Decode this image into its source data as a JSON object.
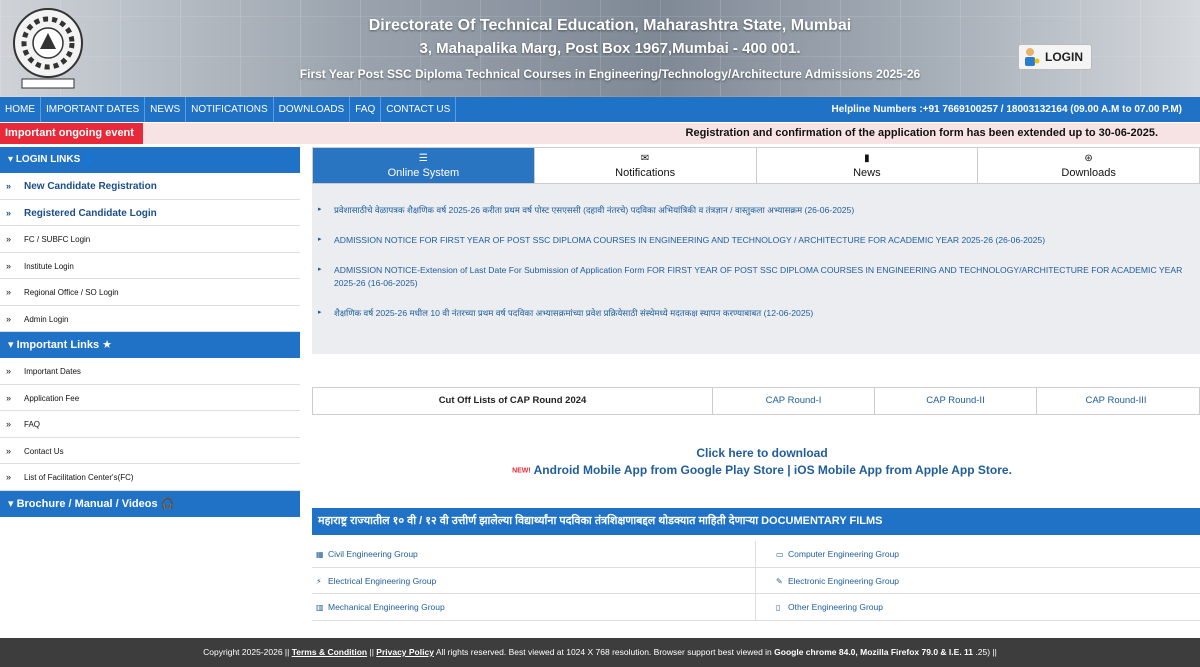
{
  "header": {
    "line1": "Directorate Of Technical Education, Maharashtra State, Mumbai",
    "line2": "3, Mahapalika Marg, Post Box 1967,Mumbai - 400 001.",
    "line3": "First Year Post SSC Diploma Technical Courses in Engineering/Technology/Architecture Admissions 2025-26",
    "login_label": "LOGIN"
  },
  "nav": {
    "items": [
      "HOME",
      "IMPORTANT DATES",
      "NEWS",
      "NOTIFICATIONS",
      "DOWNLOADS",
      "FAQ",
      "CONTACT US"
    ],
    "helpline": "Helpline Numbers  :+91 7669100257 / 18003132164   (09.00 A.M to 07.00 P.M)"
  },
  "ongoing": {
    "tag": "Important ongoing event",
    "message": "Registration and confirmation of the application form has been extended up to 30-06-2025."
  },
  "sidebar": {
    "login_head": "LOGIN LINKS",
    "login_items": [
      "New Candidate Registration",
      "Registered Candidate Login",
      "FC / SUBFC Login",
      "Institute Login",
      "Regional Office / SO Login",
      "Admin Login"
    ],
    "important_head": "Important Links",
    "important_items": [
      "Important Dates",
      "Application Fee",
      "FAQ",
      "Contact Us",
      "List of Facilitation Center's(FC)"
    ],
    "brochure_head": "Brochure / Manual / Videos"
  },
  "tabs": [
    "Online System",
    "Notifications",
    "News",
    "Downloads"
  ],
  "notices": [
    "प्रवेशासाठीचे वेळापत्रक शैक्षणिक वर्ष 2025-26 करीता प्रथम वर्ष पोस्ट एसएससी (दहावी नंतरचे) पदविका अभियांत्रिकी व तंत्रज्ञान / वास्तुकला अभ्यासक्रम (26-06-2025)",
    "ADMISSION NOTICE FOR FIRST YEAR OF POST SSC DIPLOMA COURSES IN ENGINEERING AND TECHNOLOGY / ARCHITECTURE FOR ACADEMIC YEAR 2025-26 (26-06-2025)",
    "ADMISSION NOTICE-Extension of Last Date For Submission of Application Form FOR FIRST YEAR OF POST SSC DIPLOMA COURSES IN ENGINEERING AND TECHNOLOGY/ARCHITECTURE FOR ACADEMIC YEAR 2025-26 (16-06-2025)",
    "शैक्षणिक वर्ष 2025-26 मधील 10 वी नंतरच्या प्रथम वर्ष पदविका अभ्यासक्रमांच्या प्रवेश प्रक्रियेसाठी संस्थेमध्ये मदतकक्ष स्थापन करण्याबाबत (12-06-2025)"
  ],
  "cutoff": {
    "title": "Cut Off Lists of CAP Round 2024",
    "rounds": [
      "CAP Round-I",
      "CAP Round-II",
      "CAP Round-III"
    ]
  },
  "download": {
    "heading": "Click here to download",
    "new_badge": "NEW!",
    "android": "Android Mobile App from Google Play Store",
    "separator": "|",
    "ios": "iOS Mobile App from Apple App Store."
  },
  "films": {
    "heading": "महाराष्ट्र राज्यातील १० वी / १२ वी उत्तीर्ण झालेल्या विद्यार्थ्यांना पदविका तंत्रशिक्षणाबद्दल थोडक्यात माहिती देणाऱ्या DOCUMENTARY FILMS",
    "rows": [
      [
        "Civil Engineering Group",
        "Computer Engineering Group"
      ],
      [
        "Electrical Engineering Group",
        "Electronic Engineering Group"
      ],
      [
        "Mechanical Engineering Group",
        "Other Engineering Group"
      ]
    ]
  },
  "footer": {
    "copyright": "Copyright 2025-2026 ||",
    "terms": "Terms & Condition",
    "sep": "||",
    "privacy": "Privacy Policy",
    "rights": "All rights reserved. Best viewed at 1024 X 768 resolution. Browser support best viewed in",
    "browsers": "Google chrome 84.0, Mozilla Firefox 79.0 & I.E. 11",
    "tail": ".25) ||"
  }
}
